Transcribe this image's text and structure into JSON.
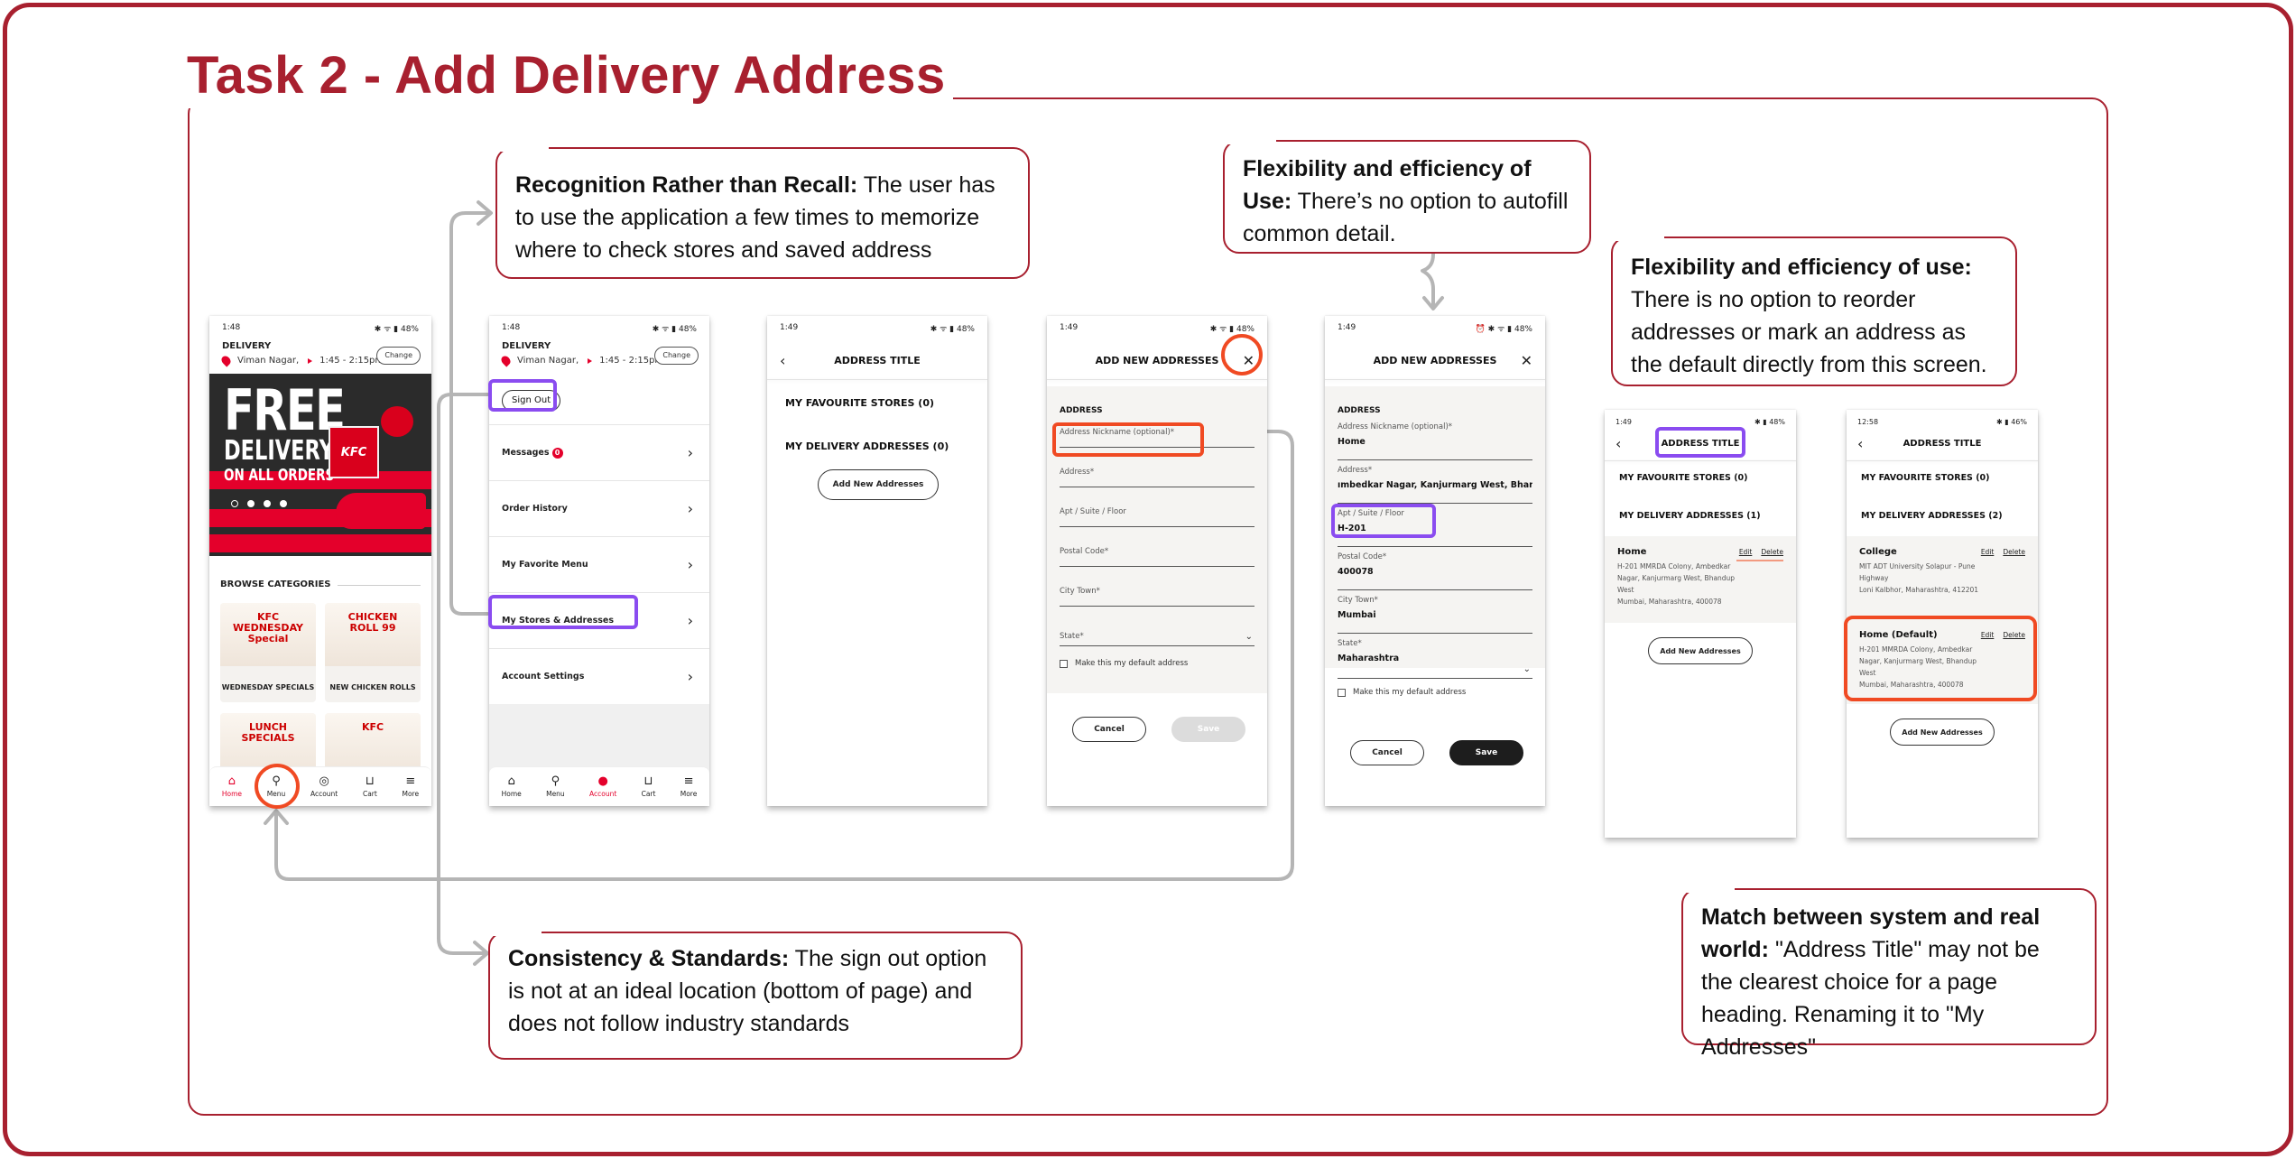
{
  "page": {
    "title": "Task 2 - Add Delivery Address",
    "colors": {
      "frame": "#a8202f",
      "highlight_purple": "#8a4cf0",
      "highlight_orange": "#f04a23",
      "kfc_red": "#e4002b",
      "connector": "#b5b5b5"
    }
  },
  "callouts": [
    {
      "heading": "Recognition Rather than Recall:",
      "body": " The user has to use the application a few times to memorize where to check stores and saved address"
    },
    {
      "heading": "Flexibility and efficiency of Use:",
      "body": " There’s no option to autofill common detail."
    },
    {
      "heading": "Flexibility and efficiency of use:",
      "body": " There is no option to reorder addresses or mark an address as the default directly from this screen."
    },
    {
      "heading": "Consistency & Standards:",
      "body": " The sign out option is not at an ideal location (bottom of page) and does not follow industry standards"
    },
    {
      "heading": "Match between system and real world:",
      "body": " \"Address Title\" may not be the clearest choice for a page heading. Renaming it to \"My Addresses\""
    }
  ],
  "screens": {
    "home": {
      "status_time": "1:48",
      "status_right": "48%",
      "delivery_label": "DELIVERY",
      "location": "Viman Nagar,",
      "time_window": "1:45 - 2:15pm",
      "change_label": "Change",
      "banner": {
        "line1": "FREE",
        "line2": "DELIVERY",
        "line3": "ON ALL ORDERS",
        "bag_brand": "KFC",
        "slide_index": 1,
        "slide_count": 4
      },
      "browse_heading": "BROWSE CATEGORIES",
      "categories": [
        {
          "label": "WEDNESDAY SPECIALS",
          "art": "KFC WEDNESDAY Special"
        },
        {
          "label": "NEW CHICKEN ROLLS",
          "art": "CHICKEN ROLL 99"
        },
        {
          "label": "",
          "art": "LUNCH SPECIALS"
        },
        {
          "label": "",
          "art": "KFC"
        }
      ],
      "tabs": [
        {
          "label": "Home",
          "icon": "home-icon",
          "glyph": "⌂",
          "active": true
        },
        {
          "label": "Menu",
          "icon": "drumstick-icon",
          "glyph": "🍗",
          "active": false
        },
        {
          "label": "Account",
          "icon": "account-icon",
          "glyph": "◎",
          "active": false
        },
        {
          "label": "Cart",
          "icon": "cart-bucket-icon",
          "glyph": "⊔",
          "active": false
        },
        {
          "label": "More",
          "icon": "hamburger-menu-icon",
          "glyph": "≡",
          "active": false
        }
      ]
    },
    "account": {
      "status_time": "1:48",
      "status_right": "48%",
      "delivery_label": "DELIVERY",
      "location": "Viman Nagar,",
      "time_window": "1:45 - 2:15pm",
      "change_label": "Change",
      "sign_out_label": "Sign Out",
      "menu_items": [
        {
          "label": "Messages",
          "badge": "0"
        },
        {
          "label": "Order History"
        },
        {
          "label": "My Favorite Menu"
        },
        {
          "label": "My Stores & Addresses"
        },
        {
          "label": "Account Settings"
        }
      ],
      "tabs": [
        {
          "label": "Home",
          "glyph": "⌂",
          "active": false
        },
        {
          "label": "Menu",
          "glyph": "🍗",
          "active": false
        },
        {
          "label": "Account",
          "glyph": "●",
          "active": true
        },
        {
          "label": "Cart",
          "glyph": "⊔",
          "active": false
        },
        {
          "label": "More",
          "glyph": "≡",
          "active": false
        }
      ]
    },
    "address_empty": {
      "status_time": "1:49",
      "status_right": "48%",
      "title": "ADDRESS TITLE",
      "fav_stores": "MY FAVOURITE STORES (0)",
      "delivery_addresses": "MY DELIVERY ADDRESSES (0)",
      "add_button": "Add New Addresses"
    },
    "add_form_empty": {
      "status_time": "1:49",
      "status_right": "48%",
      "title": "ADD NEW ADDRESSES",
      "section": "ADDRESS",
      "fields": [
        {
          "label": "Address Nickname (optional)*",
          "value": ""
        },
        {
          "label": "Address*",
          "value": ""
        },
        {
          "label": "Apt / Suite / Floor",
          "value": ""
        },
        {
          "label": "Postal Code*",
          "value": ""
        },
        {
          "label": "City  Town*",
          "value": ""
        },
        {
          "label": "State*",
          "value": ""
        }
      ],
      "default_checkbox": "Make this my default address",
      "default_checked": false,
      "cancel": "Cancel",
      "save": "Save",
      "save_enabled": false
    },
    "add_form_filled": {
      "status_time": "1:49",
      "status_right": "48%",
      "title": "ADD NEW ADDRESSES",
      "section": "ADDRESS",
      "fields": [
        {
          "label": "Address Nickname (optional)*",
          "value": "Home"
        },
        {
          "label": "Address*",
          "value": "ımbedkar Nagar, Kanjurmarg West, Bhandup West"
        },
        {
          "label": "Apt / Suite / Floor",
          "value": "H-201"
        },
        {
          "label": "Postal Code*",
          "value": "400078"
        },
        {
          "label": "City  Town*",
          "value": "Mumbai"
        },
        {
          "label": "State*",
          "value": "Maharashtra"
        }
      ],
      "default_checkbox": "Make this my default address",
      "default_checked": false,
      "cancel": "Cancel",
      "save": "Save",
      "save_enabled": true
    },
    "address_one": {
      "status_time": "1:49",
      "status_right": "48%",
      "title": "ADDRESS TITLE",
      "fav_stores": "MY FAVOURITE STORES (0)",
      "delivery_addresses": "MY DELIVERY ADDRESSES (1)",
      "addresses": [
        {
          "name": "Home",
          "lines": [
            "H-201 MMRDA Colony, Ambedkar",
            "Nagar, Kanjurmarg West, Bhandup",
            "West",
            "Mumbai, Maharashtra, 400078"
          ]
        }
      ],
      "edit": "Edit",
      "delete": "Delete",
      "add_button": "Add New Addresses"
    },
    "address_two": {
      "status_time": "12:58",
      "status_right": "46%",
      "title": "ADDRESS TITLE",
      "fav_stores": "MY FAVOURITE STORES (0)",
      "delivery_addresses": "MY DELIVERY ADDRESSES (2)",
      "addresses": [
        {
          "name": "College",
          "lines": [
            "MIT ADT University Solapur - Pune",
            "Highway",
            "Loni Kalbhor, Maharashtra, 412201"
          ]
        },
        {
          "name": "Home (Default)",
          "lines": [
            "H-201 MMRDA Colony, Ambedkar",
            "Nagar, Kanjurmarg West, Bhandup",
            "West",
            "Mumbai, Maharashtra, 400078"
          ]
        }
      ],
      "edit": "Edit",
      "delete": "Delete",
      "add_button": "Add New Addresses"
    }
  }
}
